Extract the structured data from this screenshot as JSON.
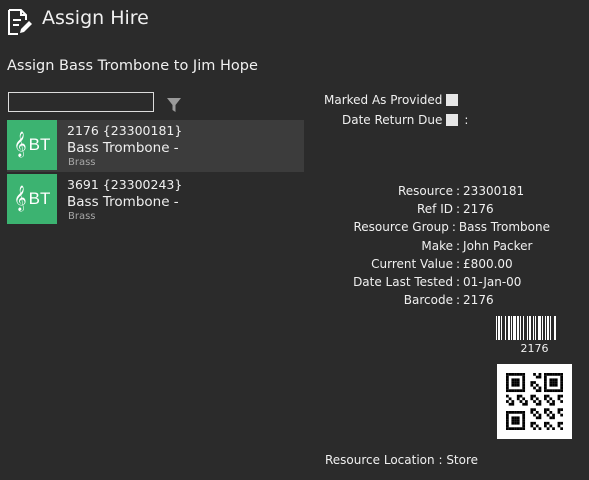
{
  "header": {
    "title": "Assign Hire",
    "icon": "edit-document-icon"
  },
  "subtitle": "Assign Bass Trombone to Jim Hope",
  "search": {
    "value": "",
    "placeholder": "",
    "filter_icon": "filter-icon"
  },
  "list": {
    "items": [
      {
        "badge": "BT",
        "badge_icon": "treble-clef-icon",
        "badge_color": "#3cb371",
        "id_line": "2176 {23300181}",
        "name": "Bass Trombone -",
        "group": "Brass",
        "selected": true
      },
      {
        "badge": "BT",
        "badge_icon": "treble-clef-icon",
        "badge_color": "#3cb371",
        "id_line": "3691 {23300243}",
        "name": "Bass Trombone -",
        "group": "Brass",
        "selected": false
      }
    ]
  },
  "options": {
    "marked_as_provided_label": "Marked As Provided",
    "marked_as_provided_checked": false,
    "date_return_due_label": "Date Return Due",
    "date_return_due_checked": false,
    "date_return_due_value": ":"
  },
  "details": {
    "rows": [
      {
        "label": "Resource",
        "value": "23300181"
      },
      {
        "label": "Ref ID",
        "value": "2176"
      },
      {
        "label": "Resource Group",
        "value": "Bass Trombone"
      },
      {
        "label": "Make",
        "value": "John Packer"
      },
      {
        "label": "Current Value",
        "value": "£800.00"
      },
      {
        "label": "Date Last Tested",
        "value": "01-Jan-00"
      },
      {
        "label": "Barcode",
        "value": "2176"
      }
    ],
    "separator": ":"
  },
  "barcode": {
    "text": "2176"
  },
  "location": {
    "label": "Resource Location",
    "separator": ":",
    "value": "Store"
  }
}
